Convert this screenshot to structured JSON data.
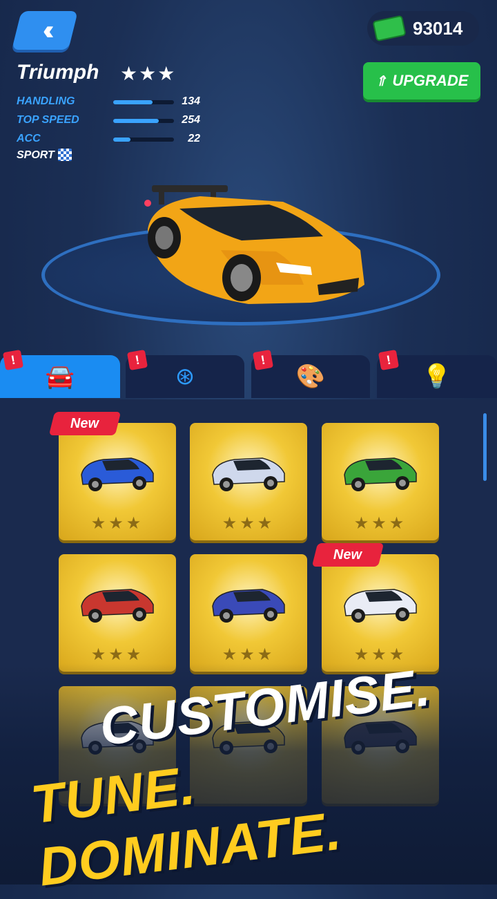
{
  "header": {
    "back_icon": "double-chevron-left-icon",
    "cash_icon": "cash-stack-icon",
    "cash_value": "93014",
    "upgrade_label": "UPGRADE",
    "upgrade_icon": "double-chevron-up-icon"
  },
  "car": {
    "name": "Triumph",
    "stars": "★★★",
    "class_label": "SPORT",
    "class_icon": "checkered-flag-icon",
    "stats": [
      {
        "label": "HANDLING",
        "value": "134",
        "fill": 0.65
      },
      {
        "label": "TOP SPEED",
        "value": "254",
        "fill": 0.75
      },
      {
        "label": "ACC",
        "value": "22",
        "fill": 0.28
      }
    ]
  },
  "tabs": [
    {
      "icon": "car-icon",
      "glyph": "🚘",
      "active": true,
      "badge": "!"
    },
    {
      "icon": "wheel-icon",
      "glyph": "⊛",
      "active": false,
      "badge": "!"
    },
    {
      "icon": "paint-palette-icon",
      "glyph": "🎨",
      "active": false,
      "badge": "!"
    },
    {
      "icon": "underglow-light-icon",
      "glyph": "💡",
      "active": false,
      "badge": "!"
    }
  ],
  "cards": [
    {
      "name": "blue-muscle-car",
      "stars": "★★★",
      "badge": "New",
      "color": "#2a5bd8"
    },
    {
      "name": "white-dragster",
      "stars": "★★★",
      "badge": "",
      "color": "#cfd8ec"
    },
    {
      "name": "green-convertible",
      "stars": "★★★",
      "badge": "",
      "color": "#3aa53a"
    },
    {
      "name": "red-roadster",
      "stars": "★★★",
      "badge": "",
      "color": "#c9372f"
    },
    {
      "name": "flag-dragster",
      "stars": "★★★",
      "badge": "",
      "color": "#3a4ab8"
    },
    {
      "name": "flag-muscle-car",
      "stars": "★★★",
      "badge": "New",
      "color": "#e9ecf5"
    },
    {
      "name": "white-suv",
      "stars": "",
      "badge": "",
      "color": "#d9d9d9"
    },
    {
      "name": "gold-card",
      "stars": "",
      "badge": "",
      "color": "#f0c430"
    },
    {
      "name": "dark-car",
      "stars": "",
      "badge": "",
      "color": "#3a3a4a"
    }
  ],
  "promo": {
    "line1": "CUSTOMISE.",
    "line2": "TUNE. DOMINATE."
  },
  "colors": {
    "accent": "#1a8cf2",
    "upgrade": "#27c04a",
    "badge": "#e8233d",
    "card": "#f1c836",
    "promo_yellow": "#ffcc1f"
  }
}
